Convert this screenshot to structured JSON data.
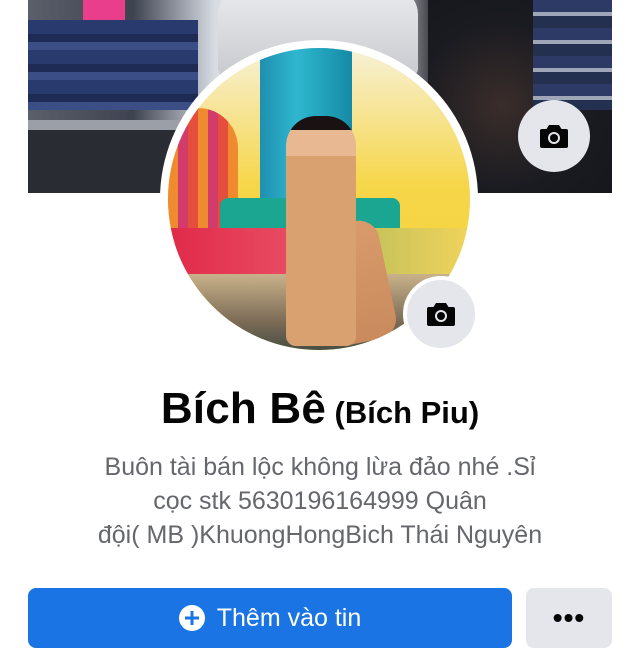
{
  "profile": {
    "name": "Bích Bê",
    "alternate_name": "(Bích Piu)",
    "bio_lines": [
      "Buôn tài bán lộc không lừa đảo nhé .Sỉ",
      "cọc stk 5630196164999 Quân",
      "đội( MB )KhuongHongBich Thái Nguyên"
    ]
  },
  "actions": {
    "add_story_label": "Thêm vào tin",
    "more_label": "•••"
  },
  "icons": {
    "cover_camera": "camera-icon",
    "avatar_camera": "camera-icon",
    "add_story": "plus-circle-icon",
    "more": "more-dots-icon"
  },
  "colors": {
    "primary_button": "#1b74e4",
    "secondary_button": "#e4e6eb",
    "name_text": "#050505",
    "bio_text": "#65676b"
  }
}
